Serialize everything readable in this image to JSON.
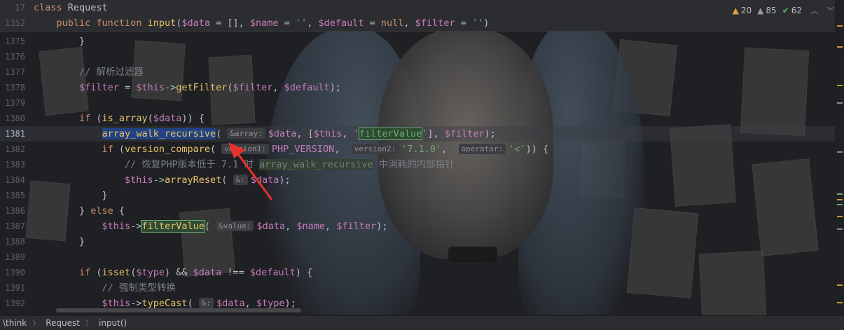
{
  "sticky": [
    {
      "num": "17",
      "parts": [
        [
          "kw",
          "class "
        ],
        [
          "pl",
          "Request"
        ]
      ]
    },
    {
      "num": "1352",
      "parts": [
        [
          "kw",
          "    public function "
        ],
        [
          "fn",
          "input"
        ],
        [
          "pl",
          "("
        ],
        [
          "var",
          "$data"
        ],
        [
          "pl",
          " = [], "
        ],
        [
          "var",
          "$name"
        ],
        [
          "pl",
          " = "
        ],
        [
          "str",
          "''"
        ],
        [
          "pl",
          ", "
        ],
        [
          "var",
          "$default"
        ],
        [
          "pl",
          " = "
        ],
        [
          "kw",
          "null"
        ],
        [
          "pl",
          ", "
        ],
        [
          "var",
          "$filter"
        ],
        [
          "pl",
          " = "
        ],
        [
          "str",
          "''"
        ],
        [
          "pl",
          ")"
        ]
      ]
    }
  ],
  "lines": [
    {
      "num": "1375",
      "parts": [
        [
          "pl",
          "        }"
        ]
      ]
    },
    {
      "num": "1376",
      "parts": []
    },
    {
      "num": "1377",
      "parts": [
        [
          "cm",
          "        // 解析过滤器"
        ]
      ]
    },
    {
      "num": "1378",
      "parts": [
        [
          "var",
          "        $filter"
        ],
        [
          "pl",
          " = "
        ],
        [
          "var",
          "$this"
        ],
        [
          "pl",
          "->"
        ],
        [
          "fn",
          "getFilter"
        ],
        [
          "pl",
          "("
        ],
        [
          "var",
          "$filter"
        ],
        [
          "pl",
          ", "
        ],
        [
          "var",
          "$default"
        ],
        [
          "pl",
          ");"
        ]
      ]
    },
    {
      "num": "1379",
      "parts": []
    },
    {
      "num": "1380",
      "parts": [
        [
          "kw",
          "        if "
        ],
        [
          "pl",
          "("
        ],
        [
          "fn",
          "is_array"
        ],
        [
          "pl",
          "("
        ],
        [
          "var",
          "$data"
        ],
        [
          "pl",
          ")) {"
        ]
      ]
    },
    {
      "num": "1381",
      "current": true,
      "parts": [
        [
          "pl",
          "            "
        ],
        [
          "fn hl-sel",
          "array_walk_recursive"
        ],
        [
          "pl",
          "( "
        ],
        [
          "hint",
          "&array:"
        ],
        [
          "var",
          "$data"
        ],
        [
          "pl",
          ", ["
        ],
        [
          "var",
          "$this"
        ],
        [
          "pl",
          ", "
        ],
        [
          "str",
          "'"
        ],
        [
          "str hl-box",
          "filterValue"
        ],
        [
          "str",
          "'"
        ],
        [
          "pl",
          "], "
        ],
        [
          "var",
          "$filter"
        ],
        [
          "pl",
          ");"
        ]
      ]
    },
    {
      "num": "1382",
      "parts": [
        [
          "kw",
          "            if "
        ],
        [
          "pl",
          "("
        ],
        [
          "fn",
          "version_compare"
        ],
        [
          "pl",
          "( "
        ],
        [
          "hint",
          "version1:"
        ],
        [
          "var",
          "PHP_VERSION"
        ],
        [
          "pl",
          ",  "
        ],
        [
          "hint",
          "version2:"
        ],
        [
          "str",
          "'7.1.0'"
        ],
        [
          "pl",
          ",  "
        ],
        [
          "hint",
          "operator:"
        ],
        [
          "str",
          "'<'"
        ],
        [
          "pl",
          ")) {"
        ]
      ]
    },
    {
      "num": "1383",
      "parts": [
        [
          "cm",
          "                // 恢复PHP版本低于 7.1 时 "
        ],
        [
          "cm hl-green",
          "array_walk_recursive"
        ],
        [
          "cm",
          " 中消耗的内部指针"
        ]
      ]
    },
    {
      "num": "1384",
      "parts": [
        [
          "var",
          "                $this"
        ],
        [
          "pl",
          "->"
        ],
        [
          "fn",
          "arrayReset"
        ],
        [
          "pl",
          "( "
        ],
        [
          "hint",
          "&:"
        ],
        [
          "var",
          "$data"
        ],
        [
          "pl",
          ");"
        ]
      ]
    },
    {
      "num": "1385",
      "parts": [
        [
          "pl",
          "            }"
        ]
      ]
    },
    {
      "num": "1386",
      "parts": [
        [
          "pl",
          "        } "
        ],
        [
          "kw",
          "else"
        ],
        [
          "pl",
          " {"
        ]
      ]
    },
    {
      "num": "1387",
      "parts": [
        [
          "var",
          "            $this"
        ],
        [
          "pl",
          "->"
        ],
        [
          "fn hl-box",
          "filterValue"
        ],
        [
          "pl",
          "( "
        ],
        [
          "hint",
          "&value:"
        ],
        [
          "var",
          "$data"
        ],
        [
          "pl",
          ", "
        ],
        [
          "var",
          "$name"
        ],
        [
          "pl",
          ", "
        ],
        [
          "var",
          "$filter"
        ],
        [
          "pl",
          ");"
        ]
      ]
    },
    {
      "num": "1388",
      "parts": [
        [
          "pl",
          "        }"
        ]
      ]
    },
    {
      "num": "1389",
      "parts": []
    },
    {
      "num": "1390",
      "parts": [
        [
          "kw",
          "        if "
        ],
        [
          "pl",
          "("
        ],
        [
          "fn",
          "isset"
        ],
        [
          "pl",
          "("
        ],
        [
          "var",
          "$type"
        ],
        [
          "pl",
          ") && "
        ],
        [
          "var",
          "$data"
        ],
        [
          "pl",
          " !== "
        ],
        [
          "var",
          "$default"
        ],
        [
          "pl",
          ") {"
        ]
      ]
    },
    {
      "num": "1391",
      "parts": [
        [
          "cm",
          "            // 强制类型转换"
        ]
      ]
    },
    {
      "num": "1392",
      "parts": [
        [
          "var",
          "            $this"
        ],
        [
          "pl",
          "->"
        ],
        [
          "fn",
          "typeCast"
        ],
        [
          "pl",
          "( "
        ],
        [
          "hint",
          "&:"
        ],
        [
          "var",
          "$data"
        ],
        [
          "pl",
          ", "
        ],
        [
          "var",
          "$type"
        ],
        [
          "pl",
          ");"
        ]
      ]
    }
  ],
  "inspections": {
    "warnings": "20",
    "weak_warnings": "85",
    "ok": "62"
  },
  "breadcrumb": {
    "root": "\\think",
    "class": "Request",
    "method": "input()"
  }
}
